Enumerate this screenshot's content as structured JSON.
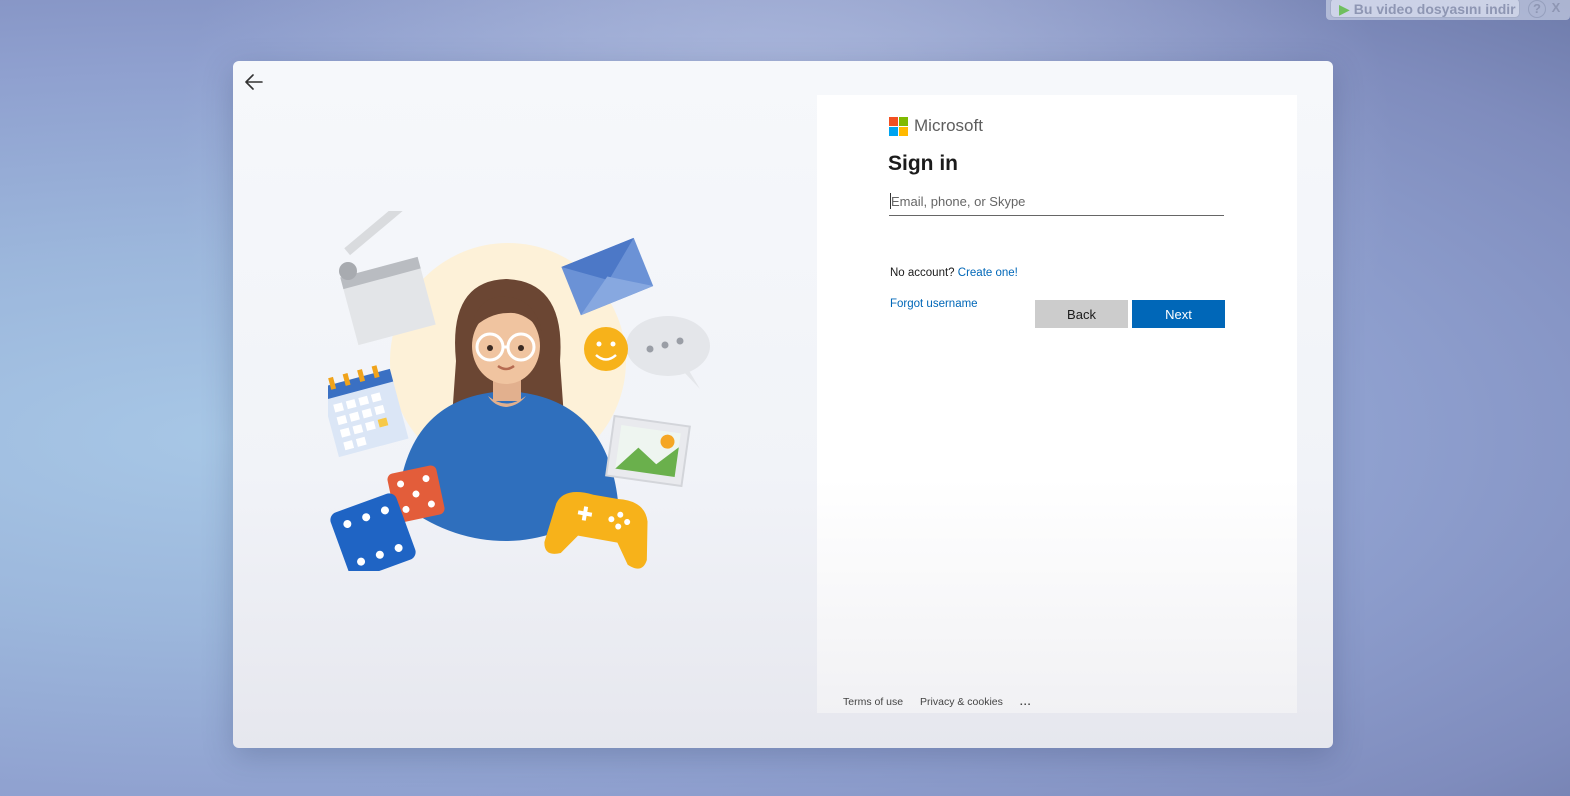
{
  "download_bar": {
    "label": "Bu video dosyasını indir",
    "help": "?",
    "close": "X"
  },
  "brand": {
    "name": "Microsoft",
    "colors": [
      "#f25022",
      "#7fba00",
      "#00a4ef",
      "#ffb900"
    ]
  },
  "signin": {
    "title": "Sign in",
    "email_placeholder": "Email, phone, or Skype",
    "email_value": "",
    "no_account_text": "No account?",
    "create_link": "Create one!",
    "forgot_link": "Forgot username",
    "back_label": "Back",
    "next_label": "Next"
  },
  "footer": {
    "terms": "Terms of use",
    "privacy": "Privacy & cookies",
    "more": "..."
  },
  "colors": {
    "accent": "#0067b8",
    "back_button": "#cccccc"
  }
}
